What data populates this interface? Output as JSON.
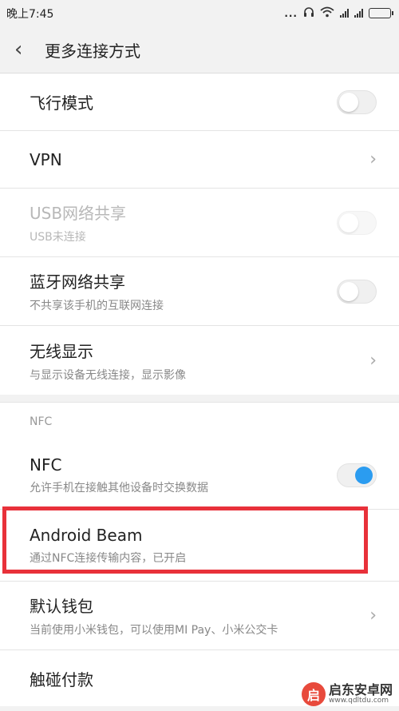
{
  "status": {
    "time": "晚上7:45",
    "dots": "...",
    "signal_label_1": "ıll",
    "signal_label_2": "ıll"
  },
  "header": {
    "back_icon": "chevron-left-icon",
    "title": "更多连接方式"
  },
  "rows": {
    "airplane": {
      "label": "飞行模式",
      "toggle": false
    },
    "vpn": {
      "label": "VPN"
    },
    "usb": {
      "label": "USB网络共享",
      "sub": "USB未连接",
      "toggle": false,
      "disabled": true
    },
    "bt": {
      "label": "蓝牙网络共享",
      "sub": "不共享该手机的互联网连接",
      "toggle": false
    },
    "wireless": {
      "label": "无线显示",
      "sub": "与显示设备无线连接，显示影像"
    }
  },
  "nfc_section": {
    "header": "NFC",
    "nfc": {
      "label": "NFC",
      "sub": "允许手机在接触其他设备时交换数据",
      "toggle": true
    },
    "beam": {
      "label": "Android Beam",
      "sub": "通过NFC连接传输内容，已开启"
    },
    "wallet": {
      "label": "默认钱包",
      "sub": "当前使用小米钱包，可以使用MI Pay、小米公交卡"
    },
    "tap_pay": {
      "label": "触碰付款"
    }
  },
  "colors": {
    "accent": "#2b9cf0",
    "highlight": "#e8313a"
  },
  "watermark": {
    "logo": "启",
    "name": "启东安卓网",
    "url": "www.qdltdu.com"
  }
}
